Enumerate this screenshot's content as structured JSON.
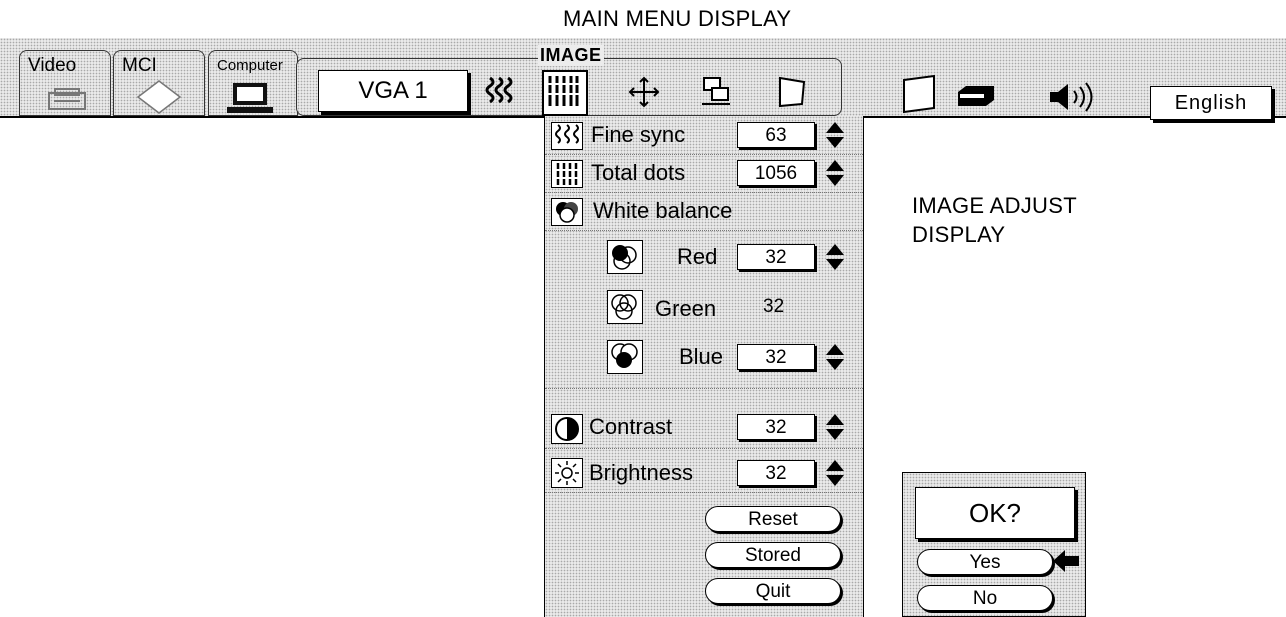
{
  "captions": {
    "main_menu": "MAIN MENU DISPLAY",
    "image_adjust_line1": "IMAGE ADJUST",
    "image_adjust_line2": "DISPLAY"
  },
  "menubar": {
    "sources": [
      {
        "label": "Video",
        "icon": "vcr-icon"
      },
      {
        "label": "MCI",
        "icon": "diamond-icon"
      },
      {
        "label": "Computer",
        "icon": "laptop-icon"
      }
    ],
    "image_group_label": "IMAGE",
    "input_mode": "VGA 1",
    "tools": [
      {
        "icon": "fine-sync-icon",
        "selected": false
      },
      {
        "icon": "image-adjust-icon",
        "selected": true
      },
      {
        "icon": "position-icon",
        "selected": false
      },
      {
        "icon": "pc-adjust-icon",
        "selected": false
      },
      {
        "icon": "keystone-icon",
        "selected": false
      }
    ],
    "right_icons": [
      "screen-icon",
      "projector-icon",
      "speaker-icon"
    ],
    "language": "English"
  },
  "panel": {
    "fine_sync": {
      "label": "Fine sync",
      "value": "63"
    },
    "total_dots": {
      "label": "Total dots",
      "value": "1056"
    },
    "white_balance": {
      "label": "White balance"
    },
    "red": {
      "label": "Red",
      "value": "32"
    },
    "green": {
      "label": "Green",
      "value": "32"
    },
    "blue": {
      "label": "Blue",
      "value": "32"
    },
    "contrast": {
      "label": "Contrast",
      "value": "32"
    },
    "brightness": {
      "label": "Brightness",
      "value": "32"
    },
    "buttons": {
      "reset": "Reset",
      "stored": "Stored",
      "quit": "Quit"
    }
  },
  "dialog": {
    "prompt": "OK?",
    "yes": "Yes",
    "no": "No",
    "pointer_icon": "arrow-left-icon"
  }
}
